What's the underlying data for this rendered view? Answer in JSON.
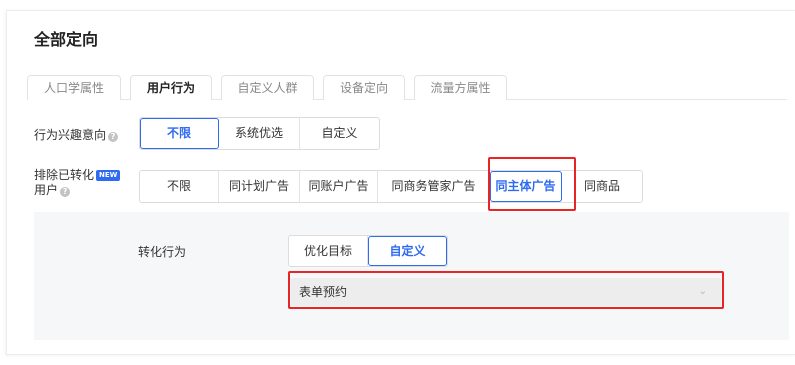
{
  "title": "全部定向",
  "tabs": [
    {
      "label": "人口学属性"
    },
    {
      "label": "用户行为"
    },
    {
      "label": "自定义人群"
    },
    {
      "label": "设备定向"
    },
    {
      "label": "流量方属性"
    }
  ],
  "interest": {
    "label": "行为兴趣意向",
    "options": [
      "不限",
      "系统优选",
      "自定义"
    ],
    "selected": "不限"
  },
  "exclude": {
    "label_line1": "排除已转化",
    "badge": "NEW",
    "label_line2": "用户",
    "options": [
      "不限",
      "同计划广告",
      "同账户广告",
      "同商务管家广告",
      "同主体广告",
      "同商品"
    ],
    "selected": "同主体广告"
  },
  "conversion": {
    "label": "转化行为",
    "options": [
      "优化目标",
      "自定义"
    ],
    "selected": "自定义",
    "select_value": "表单预约"
  },
  "colors": {
    "accent": "#2f6bf0",
    "highlight": "#e82424"
  },
  "icons": {
    "help": "question-circle-icon",
    "dropdown": "chevron-down-icon"
  }
}
